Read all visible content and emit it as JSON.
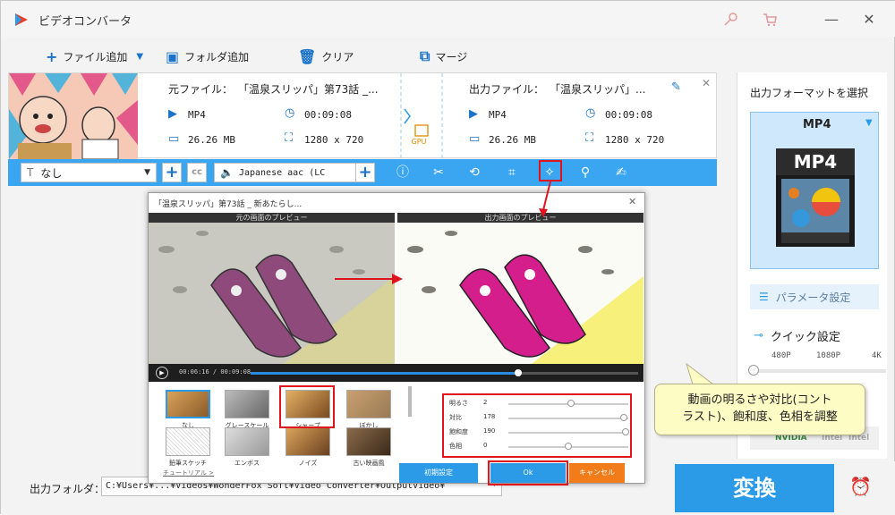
{
  "app": {
    "title": "ビデオコンバータ"
  },
  "toolbar": {
    "add_file": "ファイル追加",
    "add_folder": "フォルダ追加",
    "clear": "クリア",
    "merge": "マージ"
  },
  "file": {
    "source_label": "元ファイル：",
    "source_name": "「温泉スリッパ」第73話 _...",
    "output_label": "出力ファイル：",
    "output_name": "「温泉スリッパ」...",
    "src_format": "MP4",
    "src_duration": "00:09:08",
    "src_size": "26.26 MB",
    "src_resolution": "1280 x 720",
    "out_format": "MP4",
    "out_duration": "00:09:08",
    "out_size": "26.26 MB",
    "out_resolution": "1280 x 720",
    "gpu_label": "GPU"
  },
  "editbar": {
    "subtitle_value": "なし",
    "audio_value": "Japanese aac (LC"
  },
  "right_panel": {
    "output_format_label": "出力フォーマットを選択",
    "format_value": "MP4",
    "format_badge": "MP4",
    "param_button": "パラメータ設定",
    "quick_label": "クイック設定",
    "quick_ticks": [
      "480P",
      "1080P",
      "4K"
    ],
    "hw_labels": [
      "NVIDIA",
      "Intel",
      "Intel"
    ]
  },
  "bottom": {
    "output_folder_label": "出力フォルダ：",
    "output_path": "C:¥Users¥...¥Videos¥WonderFox Soft¥Video Converter¥OutputVideo¥",
    "convert_button": "変換"
  },
  "dialog": {
    "title": "「温泉スリッパ」第73話 _ 新あたらし...",
    "original_preview": "元の画面のプレビュー",
    "output_preview": "出力画面のプレビュー",
    "time": "00:06:16 / 00:09:08",
    "progress": 0.69,
    "filters": [
      {
        "label": "なし"
      },
      {
        "label": "グレースケール"
      },
      {
        "label": "シャープ"
      },
      {
        "label": "ぼかし"
      },
      {
        "label": "鉛筆スケッチ"
      },
      {
        "label": "エンボス"
      },
      {
        "label": "ノイズ"
      },
      {
        "label": "古い映画風"
      }
    ],
    "adjustments": [
      {
        "label": "明るさ",
        "value": "2",
        "level": 0.52
      },
      {
        "label": "対比",
        "value": "178",
        "level": 0.96
      },
      {
        "label": "飽和度",
        "value": "190",
        "level": 0.98
      },
      {
        "label": "色相",
        "value": "0",
        "level": 0.5
      }
    ],
    "tutorial": "チュートリアル >",
    "reset_button": "初期設定",
    "ok_button": "Ok",
    "cancel_button": "キャンセル"
  },
  "callout": {
    "line1": "動画の明るさや対比(コント",
    "line2": "ラスト)、飽和度、色相を調整"
  },
  "colors": {
    "accent": "#2b9be8",
    "editbar": "#3aa5f0",
    "highlight": "#e0141e",
    "cancel": "#f27c1a"
  }
}
